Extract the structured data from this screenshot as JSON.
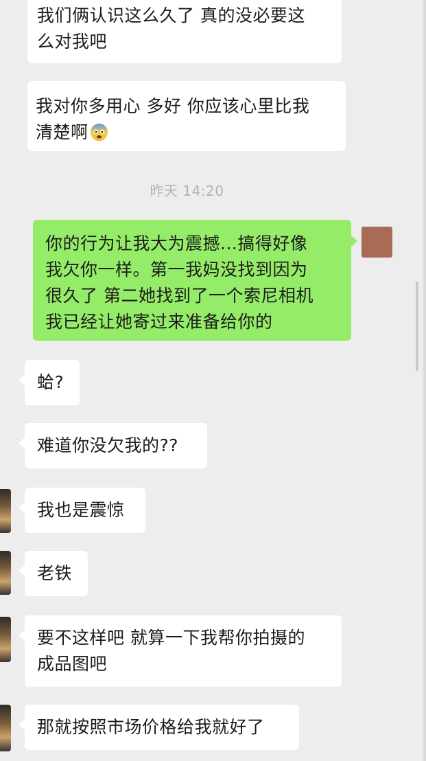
{
  "timestamp": "昨天 14:20",
  "messages": [
    {
      "side": "in",
      "text": "我们俩认识这么久了 真的没必要这\n么对我吧"
    },
    {
      "side": "in",
      "text": "我对你多用心 多好 你应该心里比我\n清楚啊",
      "emoji": "anxious-face-emoji"
    },
    {
      "side": "out",
      "text": "你的行为让我大为震撼...搞得好像\n我欠你一样。第一我妈没找到因为\n很久了 第二她找到了一个索尼相机\n我已经让她寄过来准备给你的"
    },
    {
      "side": "in",
      "text": "蛤?"
    },
    {
      "side": "in",
      "text": "难道你没欠我的??"
    },
    {
      "side": "in",
      "text": "我也是震惊"
    },
    {
      "side": "in",
      "text": "老铁"
    },
    {
      "side": "in",
      "text": "要不这样吧 就算一下我帮你拍摄的\n成品图吧"
    },
    {
      "side": "in",
      "text": "那就按照市场价格给我就好了"
    }
  ],
  "colors": {
    "background": "#ededed",
    "incoming_bubble": "#ffffff",
    "outgoing_bubble": "#95ec69",
    "timestamp_text": "#b2b2b2"
  }
}
